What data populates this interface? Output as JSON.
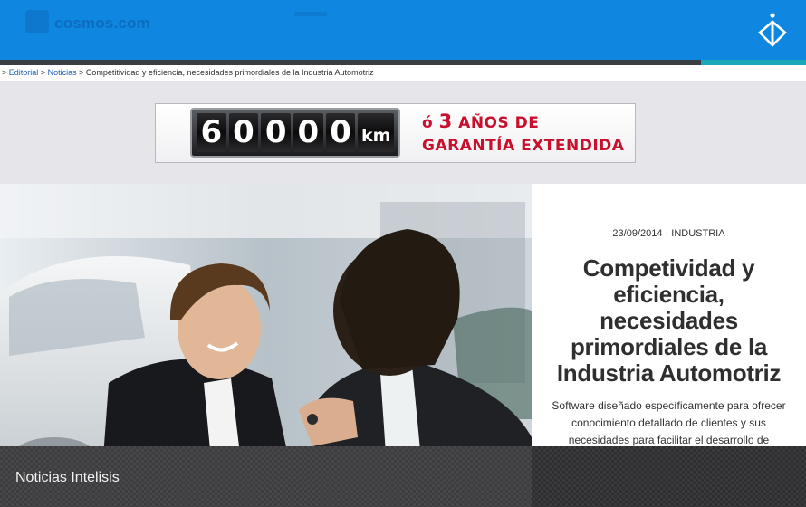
{
  "header": {
    "ghost_logo": "cosmos.com",
    "brand_logo_icon": "intelisis-logo-icon",
    "background_color": "#0f86e0",
    "accent_color": "#1aa8b8"
  },
  "breadcrumb": {
    "separator": ">",
    "editorial": "Editorial",
    "news": "Noticias",
    "current": "Competitividad y eficiencia, necesidades primordiales de la Industria Automotriz"
  },
  "ad_banner": {
    "digits": [
      "6",
      "0",
      "0",
      "0",
      "0"
    ],
    "unit": "km",
    "line1_prefix": "ó",
    "line1_number": "3",
    "line1_suffix": "AÑOS DE",
    "line2": "GARANTÍA EXTENDIDA",
    "text_color": "#c8102e"
  },
  "article": {
    "date": "23/09/2014",
    "meta_separator": "·",
    "category": "INDUSTRIA",
    "title": "Competividad y eficiencia, necesidades primordiales de la Industria Automotriz",
    "summary": "Software diseñado específicamente para ofrecer conocimiento detallado de clientes y sus necesidades para facilitar el desarrollo de mejores estrategias en la industria."
  },
  "footer": {
    "title": "Noticias Intelisis"
  }
}
